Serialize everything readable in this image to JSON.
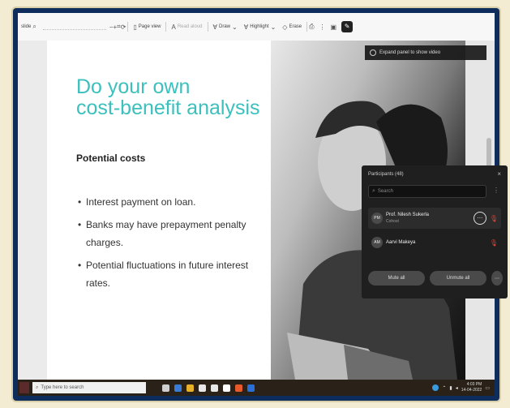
{
  "toolbar": {
    "zoom_label": "slide",
    "page_view_label": "Page view",
    "read_aloud_label": "Read aloud",
    "draw_label": "Draw",
    "highlight_label": "Highlight",
    "erase_label": "Erase"
  },
  "slide": {
    "title_line1": "Do your own",
    "title_line2": "cost-benefit analysis",
    "subtitle": "Potential costs",
    "bullets": [
      "Interest payment on loan.",
      "Banks may have prepayment penalty charges.",
      "Potential fluctuations in future interest rates."
    ],
    "title_color": "#3cc0bd"
  },
  "video": {
    "expand_hint": "Expand panel to show video"
  },
  "participants": {
    "header": "Participants (48)",
    "search_placeholder": "Search",
    "people": [
      {
        "initials": "PM",
        "name": "Prof. Nilesh Sukerla",
        "role": "Cohost"
      },
      {
        "initials": "AM",
        "name": "Aarvi Makeya",
        "role": ""
      }
    ],
    "mute_all_label": "Mute all",
    "unmute_all_label": "Unmute all"
  },
  "taskbar": {
    "search_text": "Type here to search",
    "time": "4:03 PM",
    "date": "14-04-2022"
  },
  "colors": {
    "frame": "#0f2d5c",
    "accent_red": "#e0463a"
  }
}
